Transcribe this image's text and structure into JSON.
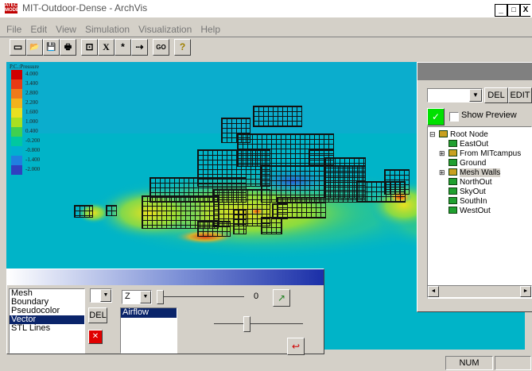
{
  "window": {
    "title": "MIT-Outdoor-Dense - ArchVis",
    "icon_text": "ATEC\nMODE",
    "min": "_",
    "max": "□",
    "close": "X"
  },
  "menu": [
    "File",
    "Edit",
    "View",
    "Simulation",
    "Visualization",
    "Help"
  ],
  "toolbar": [
    {
      "icon": "new-icon",
      "glyph": "▭"
    },
    {
      "icon": "open-icon",
      "glyph": "📂"
    },
    {
      "icon": "save-icon",
      "glyph": "💾"
    },
    {
      "icon": "print-icon",
      "glyph": "🖶"
    },
    {
      "icon": "box-icon",
      "glyph": "⊡"
    },
    {
      "icon": "x-icon",
      "glyph": "X"
    },
    {
      "icon": "star-icon",
      "glyph": "*"
    },
    {
      "icon": "arrow-icon",
      "glyph": "⇢"
    },
    {
      "icon": "go-icon",
      "glyph": "GO"
    },
    {
      "icon": "help-icon",
      "glyph": "?"
    }
  ],
  "legend": {
    "title": "P.C.:Pressure",
    "items": [
      {
        "label": "4.000",
        "color": "#d00000"
      },
      {
        "label": "3.400",
        "color": "#e83a14"
      },
      {
        "label": "2.800",
        "color": "#ef7a1a"
      },
      {
        "label": "2.200",
        "color": "#f2b21c"
      },
      {
        "label": "1.600",
        "color": "#e8e020"
      },
      {
        "label": "1.000",
        "color": "#a8e020"
      },
      {
        "label": "0.400",
        "color": "#40d050"
      },
      {
        "label": "-0.200",
        "color": "#00c8a0"
      },
      {
        "label": "-0.800",
        "color": "#00b0d0"
      },
      {
        "label": "-1.400",
        "color": "#2080e0"
      },
      {
        "label": "-2.000",
        "color": "#3040c0"
      }
    ]
  },
  "right_panel": {
    "del_label": "DEL",
    "edit_label": "EDIT",
    "show_preview_label": "Show Preview",
    "tree": [
      {
        "label": "Root Node",
        "kind": "folder",
        "expander": "⊟"
      },
      {
        "label": "EastOut",
        "kind": "leaf",
        "expander": ""
      },
      {
        "label": "From MITcampus",
        "kind": "folder",
        "expander": "⊞"
      },
      {
        "label": "Ground",
        "kind": "leaf",
        "expander": ""
      },
      {
        "label": "Mesh Walls",
        "kind": "folder",
        "expander": "⊞"
      },
      {
        "label": "NorthOut",
        "kind": "leaf",
        "expander": ""
      },
      {
        "label": "SkyOut",
        "kind": "leaf",
        "expander": ""
      },
      {
        "label": "SouthIn",
        "kind": "leaf",
        "expander": ""
      },
      {
        "label": "WestOut",
        "kind": "leaf",
        "expander": ""
      }
    ],
    "scroll_left": "◄",
    "scroll_right": "►"
  },
  "bottom_panel": {
    "types": [
      "Mesh",
      "Boundary",
      "Pseudocolor",
      "Vector",
      "STL Lines"
    ],
    "selected_type": "Vector",
    "axis_value": "Z",
    "slider_value": "0",
    "del_label": "DEL",
    "remove_glyph": "✕",
    "layers": [
      "Airflow"
    ],
    "dropdown_arrow": "▼"
  },
  "status": {
    "num": "NUM"
  }
}
